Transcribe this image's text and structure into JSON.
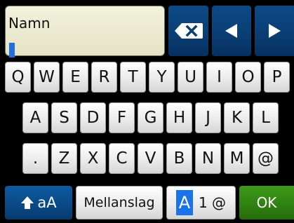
{
  "input": {
    "label": "Namn",
    "value": ""
  },
  "controls": {
    "backspace_icon": "backspace-icon",
    "left_icon": "arrow-left-icon",
    "right_icon": "arrow-right-icon"
  },
  "rows": [
    [
      "Q",
      "W",
      "E",
      "R",
      "T",
      "Y",
      "U",
      "I",
      "O",
      "P"
    ],
    [
      "A",
      "S",
      "D",
      "F",
      "G",
      "H",
      "J",
      "K",
      "L"
    ],
    [
      ".",
      "Z",
      "X",
      "C",
      "V",
      "B",
      "N",
      "M",
      "@"
    ]
  ],
  "bottom": {
    "shift_label": "aA",
    "space_label": "Mellanslag",
    "mode_active": "A",
    "mode_rest": "1 @",
    "ok_label": "OK"
  },
  "colors": {
    "accent_blue": "#0a4a87",
    "ok_green": "#2f8211",
    "caret_blue": "#1e6fe0"
  }
}
